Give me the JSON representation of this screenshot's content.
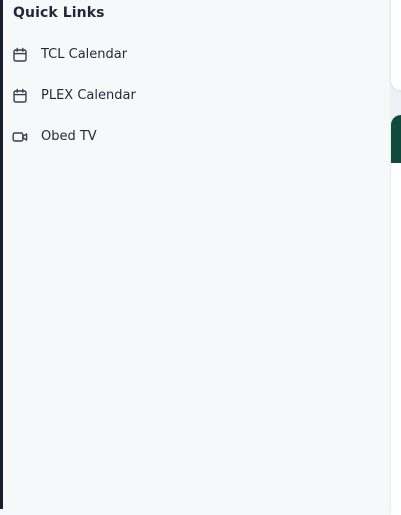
{
  "quick_links": {
    "title": "Quick Links",
    "items": [
      {
        "label": "TCL Calendar",
        "icon": "calendar-icon"
      },
      {
        "label": "PLEX Calendar",
        "icon": "calendar-icon"
      },
      {
        "label": "Obed TV",
        "icon": "video-camera-icon"
      }
    ]
  },
  "colors": {
    "page_background": "#f7f8fa",
    "left_rail": "#1a1f2c",
    "card_header_accent": "#0f4a3a",
    "text": "#1f2937"
  }
}
